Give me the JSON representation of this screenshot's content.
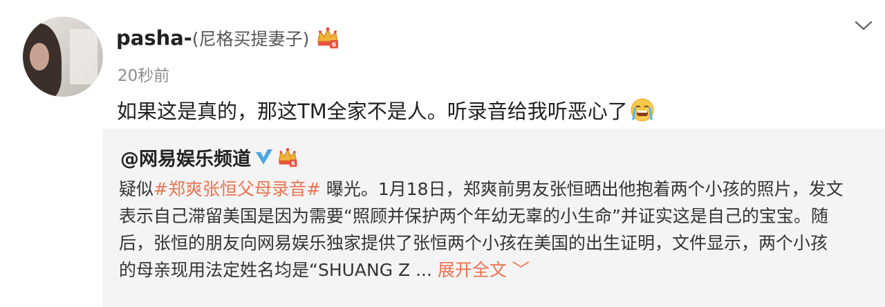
{
  "post": {
    "username": "pasha-",
    "remark": "(尼格买提妻子)",
    "timestamp": "20秒前",
    "comment": "如果这是真的，那这TM全家不是人。听录音给我听恶心了"
  },
  "icons": {
    "avatar": "avatar",
    "crown_badge": "crown-badge-icon",
    "emoji": "crying-emoji-icon",
    "menu": "chevron-down-icon",
    "verified": "verified-v-icon"
  },
  "repost": {
    "author": "@网易娱乐频道",
    "lines": [
      {
        "prefix": "疑似",
        "hashtag": "#郑爽张恒父母录音#",
        "text": " 曝光。1月18日，郑爽前男友张恒晒出他抱着两个小孩的照片，发文"
      },
      {
        "text": "表示自己滞留美国是因为需要“照顾并保护两个年幼无辜的小生命”并证实这是自己的宝宝。随"
      },
      {
        "text": "后，张恒的朋友向网易娱乐独家提供了张恒两个小孩在美国的出生证明，文件显示，两个小孩"
      },
      {
        "text": "的母亲现用法定姓名均是“SHUANG Z ... ",
        "link": "展开全文",
        "link_suffix": " ﹀"
      }
    ]
  },
  "colors": {
    "accent_link": "#eb7350",
    "verified_blue": "#4aa6e8",
    "repost_bg": "#f4f4f4",
    "timestamp_gray": "#8d8d8d"
  }
}
